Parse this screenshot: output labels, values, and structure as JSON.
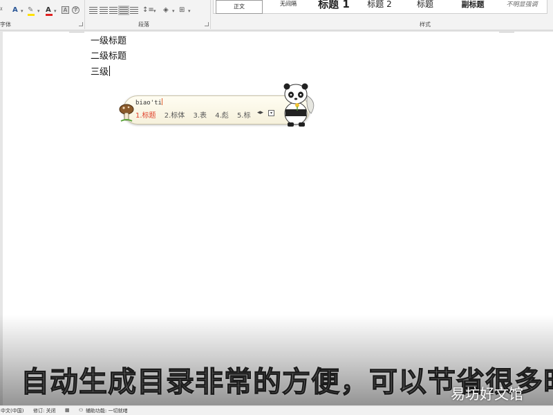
{
  "ribbon": {
    "groups": {
      "font": "字体",
      "paragraph": "段落",
      "styles": "样式"
    },
    "styles_gallery": [
      {
        "label": "正文"
      },
      {
        "label": "无间隔"
      },
      {
        "label": "标题 1"
      },
      {
        "label": "标题 2"
      },
      {
        "label": "标题"
      },
      {
        "label": "副标题"
      },
      {
        "label": "不明显强调"
      }
    ]
  },
  "document": {
    "lines": [
      "一级标题",
      "二级标题",
      "三级"
    ]
  },
  "ime": {
    "composition": "biao'ti",
    "candidates": [
      "1.标题",
      "2.标体",
      "3.表",
      "4.彪",
      "5.标"
    ]
  },
  "subtitle": "自动生成目录非常的方便，可以节省很多时",
  "watermark": "易坊好文馆",
  "statusbar": {
    "language": "中文(中国)",
    "track_changes": "修订: 关闭",
    "accessibility": "辅助功能: 一切就绪"
  }
}
